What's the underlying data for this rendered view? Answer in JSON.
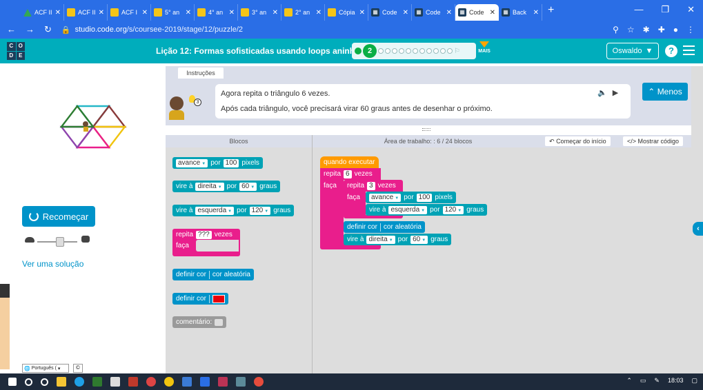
{
  "browser": {
    "tabs": [
      {
        "title": "ACF II",
        "icon": "drive-icon"
      },
      {
        "title": "ACF II",
        "icon": "slides-icon"
      },
      {
        "title": "ACF I",
        "icon": "slides-icon"
      },
      {
        "title": "5° an",
        "icon": "slides-icon"
      },
      {
        "title": "4° an",
        "icon": "slides-icon"
      },
      {
        "title": "3° an",
        "icon": "slides-icon"
      },
      {
        "title": "2° an",
        "icon": "slides-icon"
      },
      {
        "title": "Cópia",
        "icon": "slides-icon"
      },
      {
        "title": "Code",
        "icon": "code-icon"
      },
      {
        "title": "Code",
        "icon": "code-icon"
      },
      {
        "title": "Code",
        "icon": "code-icon"
      },
      {
        "title": "Back",
        "icon": "code-icon"
      }
    ],
    "active_tab": 10,
    "url_domain": "studio.code.org",
    "url_path": "/s/coursee-2019/stage/12/puzzle/2"
  },
  "header": {
    "logo": [
      "C",
      "O",
      "D",
      "E"
    ],
    "lesson_title": "Lição 12: Formas sofisticadas usando loops aninhados",
    "current_level": "2",
    "more_label": "MAIS",
    "user_name": "Oswaldo",
    "help_label": "?"
  },
  "instructions": {
    "tab_label": "Instruções",
    "line1": "Agora repita o triângulo 6 vezes.",
    "line2": "Após cada triângulo, você precisará virar 60 graus antes de desenhar o próximo.",
    "hint_count": "3",
    "less_button": "Menos"
  },
  "left": {
    "restart_label": "Recomeçar",
    "solution_link": "Ver uma solução",
    "language": "Português (",
    "speed_level": 0.55
  },
  "toolbox": {
    "title": "Blocos",
    "blocks": {
      "b1": {
        "a": "avance",
        "n": "100",
        "u": "pixels",
        "p": "por"
      },
      "b2": {
        "a": "vire à",
        "d": "direita",
        "p": "por",
        "n": "60",
        "u": "graus"
      },
      "b3": {
        "a": "vire à",
        "d": "esquerda",
        "p": "por",
        "n": "120",
        "u": "graus"
      },
      "b4": {
        "a": "repita",
        "n": "???",
        "u": "vezes",
        "f": "faça"
      },
      "b5": {
        "a": "definir cor",
        "v": "cor aleatória"
      },
      "b6": {
        "a": "definir cor"
      },
      "b7": {
        "a": "comentário:"
      }
    }
  },
  "workspace": {
    "title": "Área de trabalho: : 6 / 24 blocos",
    "start_over": "Começar do início",
    "show_code": "Mostrar código",
    "when_run": "quando executar",
    "outer": {
      "a": "repita",
      "n": "6",
      "u": "vezes",
      "f": "faça"
    },
    "inner": {
      "a": "repita",
      "n": "3",
      "u": "vezes",
      "f": "faça"
    },
    "move": {
      "a": "avance",
      "p": "por",
      "n": "100",
      "u": "pixels"
    },
    "turn_left": {
      "a": "vire à",
      "d": "esquerda",
      "p": "por",
      "n": "120",
      "u": "graus"
    },
    "setcolor": {
      "a": "definir cor",
      "v": "cor aleatória"
    },
    "turn_right": {
      "a": "vire à",
      "d": "direita",
      "p": "por",
      "n": "60",
      "u": "graus"
    }
  },
  "taskbar": {
    "time": "18:03"
  },
  "colors": {
    "browser": "#2a6ee6",
    "header": "#00adbc",
    "teal": "#00a2b5",
    "blue": "#0093c9",
    "pink": "#e91e8c",
    "orange": "#ff9a00"
  }
}
